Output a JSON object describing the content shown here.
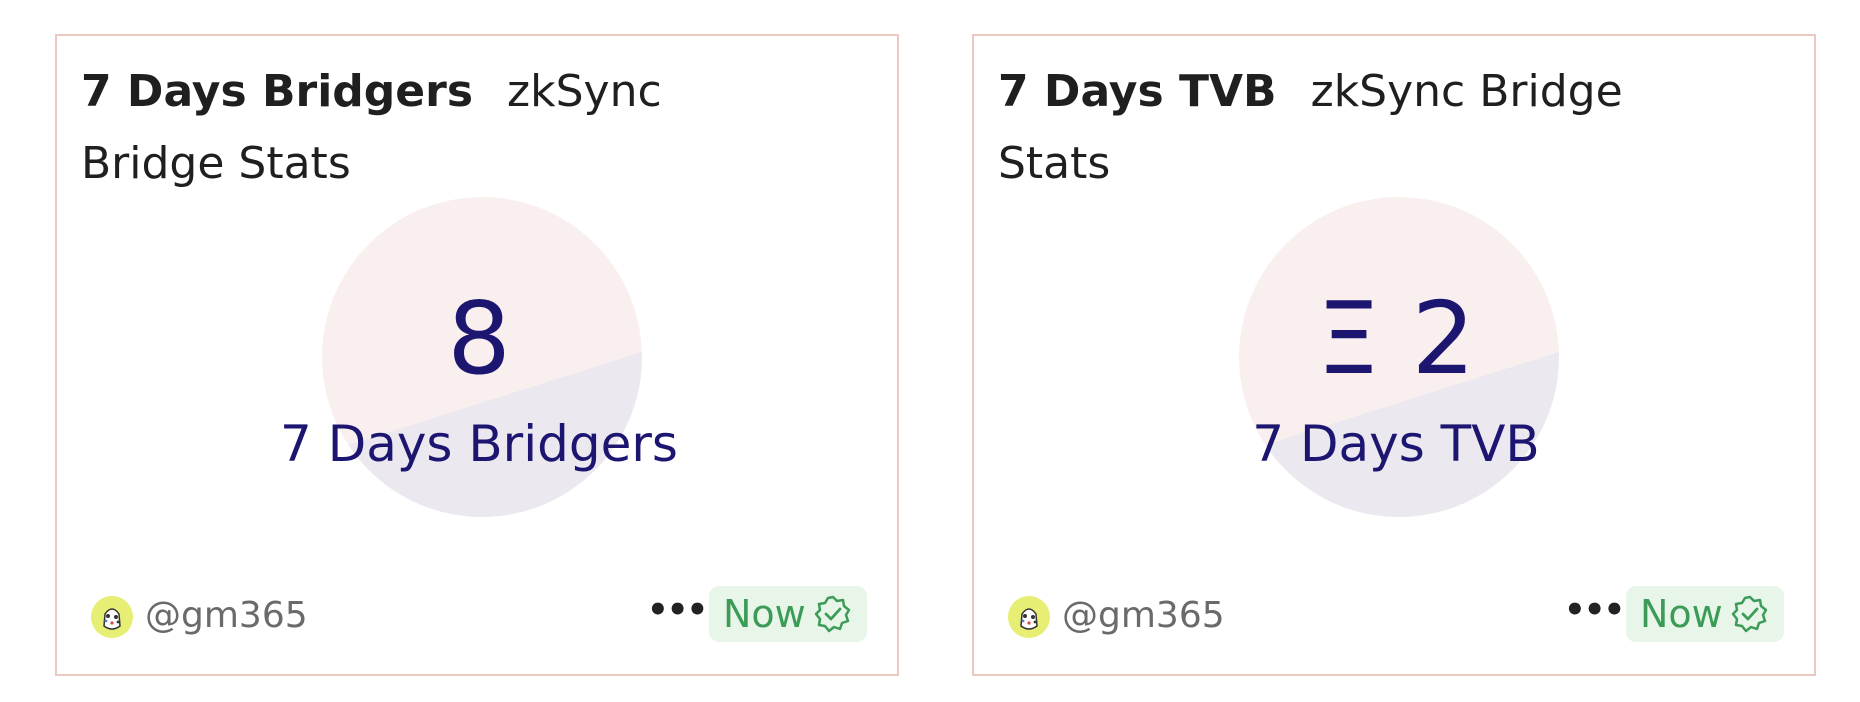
{
  "cards": [
    {
      "title_main": "7 Days Bridgers",
      "title_sub": "zkSync Bridge Stats",
      "value": "8",
      "label": "7 Days Bridgers",
      "user": "@gm365",
      "status": "Now",
      "more_icon": "ellipsis-icon",
      "status_icon": "verified-check-icon"
    },
    {
      "title_main": "7 Days TVB",
      "title_sub": "zkSync Bridge Stats",
      "value": "Ξ 2",
      "label": "7 Days TVB",
      "user": "@gm365",
      "status": "Now",
      "more_icon": "ellipsis-icon",
      "status_icon": "verified-check-icon"
    }
  ],
  "colors": {
    "card_border": "#ecc9c0",
    "value_text": "#1c1670",
    "disc_top": "#f8efee",
    "disc_bottom": "#ebe8f0",
    "badge_bg": "#e8f6ea",
    "badge_text": "#3c9c57"
  }
}
